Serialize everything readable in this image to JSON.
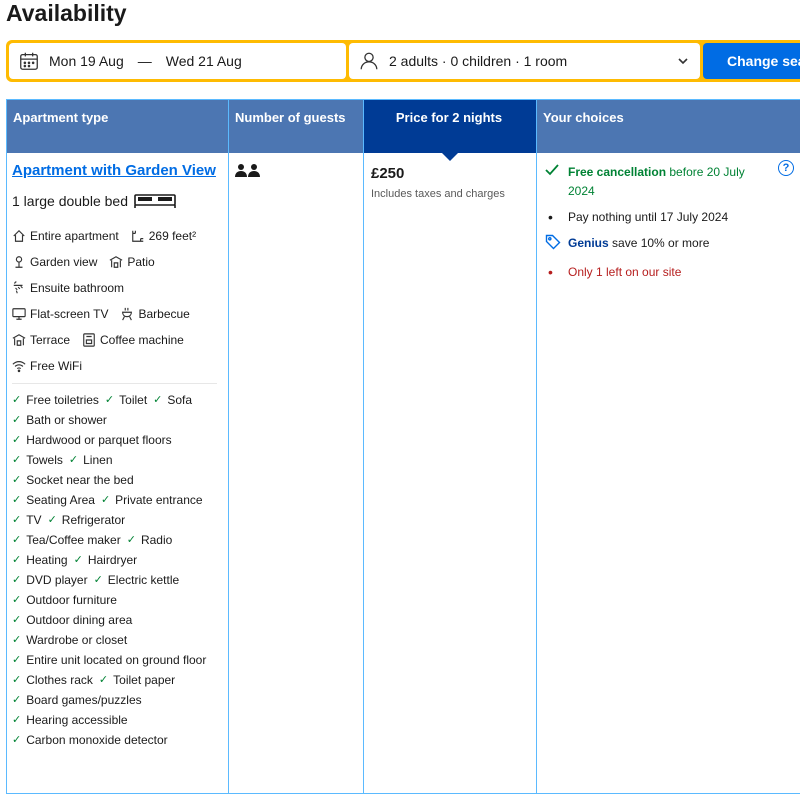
{
  "page": {
    "title": "Availability"
  },
  "search": {
    "dates": {
      "from": "Mon 19 Aug",
      "separator": "—",
      "to": "Wed 21 Aug",
      "icon": "calendar-icon"
    },
    "guests": {
      "label": "2 adults · 0 children · 1 room",
      "icon": "person-icon"
    },
    "button": "Change search"
  },
  "table": {
    "headers": [
      "Apartment type",
      "Number of guests",
      "Price for 2 nights",
      "Your choices"
    ],
    "room": {
      "name": "Apartment with Garden View",
      "bed": "1 large double bed",
      "facilities": [
        [
          {
            "icon": "house-icon",
            "label": "Entire apartment"
          },
          {
            "icon": "floor-area-icon",
            "label": "269 feet²"
          }
        ],
        [
          {
            "icon": "garden-icon",
            "label": "Garden view"
          },
          {
            "icon": "patio-icon",
            "label": "Patio"
          }
        ],
        [
          {
            "icon": "bath-icon",
            "label": "Ensuite bathroom"
          }
        ],
        [
          {
            "icon": "tv-icon",
            "label": "Flat-screen TV"
          },
          {
            "icon": "barbecue-icon",
            "label": "Barbecue"
          }
        ],
        [
          {
            "icon": "terrace-icon",
            "label": "Terrace"
          },
          {
            "icon": "coffee-machine-icon",
            "label": "Coffee machine"
          }
        ],
        [
          {
            "icon": "wifi-icon",
            "label": "Free WiFi"
          }
        ]
      ],
      "amenities": [
        [
          "Free toiletries",
          "Toilet",
          "Sofa"
        ],
        [
          "Bath or shower"
        ],
        [
          "Hardwood or parquet floors"
        ],
        [
          "Towels",
          "Linen"
        ],
        [
          "Socket near the bed"
        ],
        [
          "Seating Area",
          "Private entrance"
        ],
        [
          "TV",
          "Refrigerator"
        ],
        [
          "Tea/Coffee maker",
          "Radio"
        ],
        [
          "Heating",
          "Hairdryer"
        ],
        [
          "DVD player",
          "Electric kettle"
        ],
        [
          "Outdoor furniture"
        ],
        [
          "Outdoor dining area"
        ],
        [
          "Wardrobe or closet"
        ],
        [
          "Entire unit located on ground floor"
        ],
        [
          "Clothes rack",
          "Toilet paper"
        ],
        [
          "Board games/puzzles"
        ],
        [
          "Hearing accessible"
        ],
        [
          "Carbon monoxide detector"
        ]
      ]
    },
    "guests_icon": "two-persons-icon",
    "price": {
      "amount": "£250",
      "note": "Includes taxes and charges"
    },
    "choices": {
      "cancellation_bold": "Free cancellation",
      "cancellation_rest": " before 20 July 2024",
      "pay": "Pay nothing until 17 July 2024",
      "genius_bold": "Genius",
      "genius_rest": " save 10% or more",
      "scarcity": "Only 1 left on our site"
    }
  },
  "colors": {
    "accent": "#006ce4",
    "header_bg": "#4c76b2",
    "header_active": "#003b95",
    "search_border": "#febb02",
    "green": "#008234",
    "red": "#b61e1e"
  }
}
